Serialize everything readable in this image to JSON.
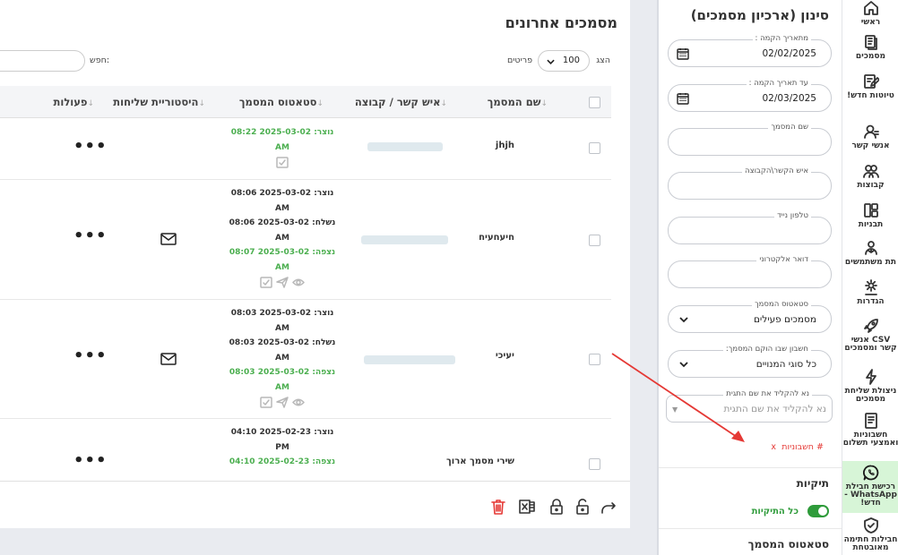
{
  "nav": {
    "items": [
      {
        "label": "ראשי",
        "icon": "home-icon"
      },
      {
        "label": "מסמכים",
        "icon": "documents-icon"
      },
      {
        "label": "טיוטות חדש!",
        "icon": "drafts-icon"
      },
      {
        "label": "אנשי קשר",
        "icon": "contacts-icon"
      },
      {
        "label": "קבוצות",
        "icon": "groups-icon"
      },
      {
        "label": "תבניות",
        "icon": "templates-icon"
      },
      {
        "label": "תת משתמשים",
        "icon": "sub-users-icon"
      },
      {
        "label": "הגדרות",
        "icon": "settings-icon"
      },
      {
        "label": "CSV אנשי קשר ומסמכים",
        "icon": "csv-rocket-icon"
      },
      {
        "label": "ניצולת שליחת מסמכים",
        "icon": "usage-bolt-icon"
      },
      {
        "label": "חשבוניות ואמצעי תשלום",
        "icon": "invoices-icon"
      },
      {
        "label": "רכישת חבילת WhatsApp - חדש!",
        "icon": "whatsapp-icon"
      },
      {
        "label": "חבילות חתימה מאובטחת",
        "icon": "secure-shield-icon"
      }
    ]
  },
  "filters": {
    "title": "סינון (ארכיון מסמכים)",
    "date_from_label": "מתאריך הקמה :",
    "date_from": "02/02/2025",
    "date_to_label": "עד תאריך הקמה :",
    "date_to": "02/03/2025",
    "doc_name_label": "שם המסמך",
    "contact_label": "איש הקשר\\הקבוצה",
    "mobile_label": "טלפון נייד",
    "email_label": "דואר אלקטרוני",
    "status_label": "סטאטוס המסמך",
    "status_value": "מסמכים פעילים",
    "account_label": "חשבון שבו הוקם המסמך:",
    "account_value": "כל סוגי המנויים",
    "condition_label": "נא להקליד את שם התגית",
    "condition_placeholder": "נא להקליד את שם התגית",
    "tag_hash": "# חשבוניות",
    "tag_remove": "x",
    "folders_title": "תיקיות",
    "all_folders": "כל התיקיות",
    "doc_status_title": "סטאטוס המסמך"
  },
  "main": {
    "title": "מסמכים אחרונים",
    "show_label": "הצג",
    "page_size": "100",
    "items_label": "פריטים",
    "search_label": "חפש:",
    "columns": [
      "שם המסמך",
      "איש קשר / קבוצה",
      "סטאטוס המסמך",
      "היסטוריית שליחות",
      "פעולות"
    ],
    "sort_glyph": "↓",
    "actions_glyph": "•••",
    "rows": [
      {
        "name": "jhjh",
        "status": [
          {
            "t": "נוצר: 2025-03-02 08:22",
            "g": true
          },
          {
            "t": "AM",
            "g": true
          }
        ]
      },
      {
        "name": "חיעחעיח",
        "status": [
          {
            "t": "נוצר: 2025-03-02 08:06",
            "g": false
          },
          {
            "t": "AM",
            "g": false
          },
          {
            "t": "נשלח: 2025-03-02 08:06",
            "g": false
          },
          {
            "t": "AM",
            "g": false
          },
          {
            "t": "נצפה: 2025-03-02 08:07",
            "g": true
          },
          {
            "t": "AM",
            "g": true
          }
        ]
      },
      {
        "name": "יעיכי",
        "status": [
          {
            "t": "נוצר: 2025-03-02 08:03",
            "g": false
          },
          {
            "t": "AM",
            "g": false
          },
          {
            "t": "נשלח: 2025-03-02 08:03",
            "g": false
          },
          {
            "t": "AM",
            "g": false
          },
          {
            "t": "נצפה: 2025-03-02 08:03",
            "g": true
          },
          {
            "t": "AM",
            "g": true
          }
        ]
      },
      {
        "name": "שירי מסמך ארוך",
        "status": [
          {
            "t": "נוצר: 2025-02-23 04:10",
            "g": false
          },
          {
            "t": "PM",
            "g": false
          },
          {
            "t": "נצפה: 2025-02-23 04:10",
            "g": true
          }
        ]
      }
    ]
  },
  "colors": {
    "accent_green": "#4caf50",
    "annotation_red": "#e53935",
    "whatsapp_bg": "#d7f5d7"
  }
}
